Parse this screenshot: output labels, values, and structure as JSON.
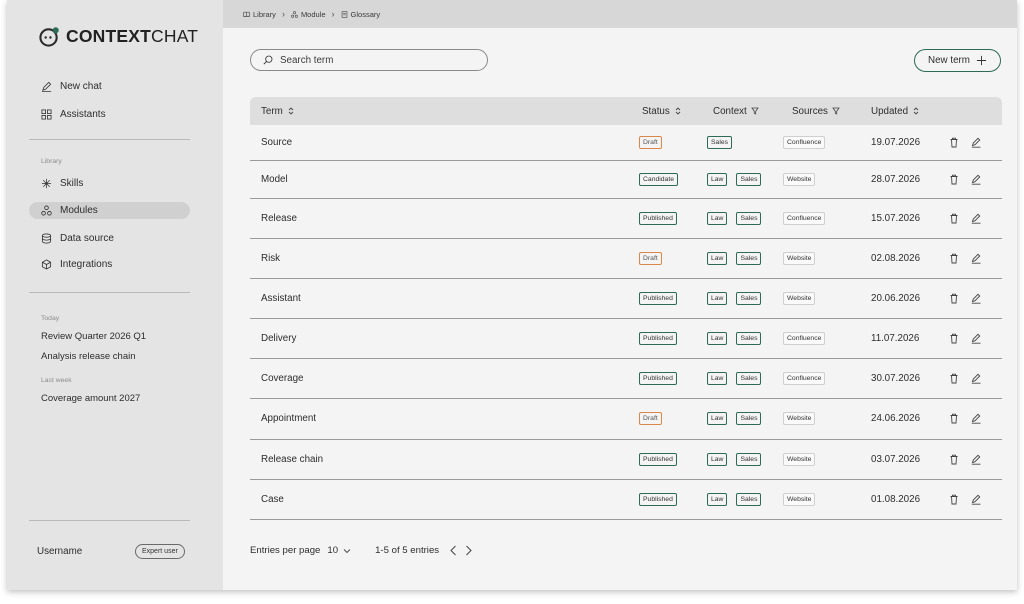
{
  "app": {
    "logo_bold": "CONTEXT",
    "logo_light": "CHAT"
  },
  "breadcrumb": [
    {
      "label": "Library",
      "icon": "book-icon"
    },
    {
      "label": "Module",
      "icon": "module-icon"
    },
    {
      "label": "Glossary",
      "icon": "glossary-icon"
    }
  ],
  "sidebar": {
    "primary": [
      {
        "label": "New chat",
        "icon": "pencil-icon"
      },
      {
        "label": "Assistants",
        "icon": "grid-icon"
      }
    ],
    "library_label": "Library",
    "library": [
      {
        "label": "Skills",
        "icon": "sparkle-icon"
      },
      {
        "label": "Modules",
        "icon": "modules-icon",
        "active": true
      },
      {
        "label": "Data source",
        "icon": "database-icon"
      },
      {
        "label": "Integrations",
        "icon": "cube-icon"
      }
    ],
    "history": [
      {
        "label": "Today",
        "items": [
          "Review Quarter 2026 Q1",
          "Analysis release chain"
        ]
      },
      {
        "label": "Last week",
        "items": [
          "Coverage amount 2027"
        ]
      }
    ],
    "user": {
      "name": "Username",
      "role": "Expert user"
    }
  },
  "toolbar": {
    "search_placeholder": "Search term",
    "new_term_label": "New term"
  },
  "table": {
    "columns": {
      "term": "Term",
      "status": "Status",
      "context": "Context",
      "sources": "Sources",
      "updated": "Updated"
    },
    "rows": [
      {
        "term": "Source",
        "status": "Draft",
        "context": [
          "Sales"
        ],
        "source": "Confluence",
        "updated": "19.07.2026"
      },
      {
        "term": "Model",
        "status": "Candidate",
        "context": [
          "Law",
          "Sales"
        ],
        "source": "Website",
        "updated": "28.07.2026"
      },
      {
        "term": "Release",
        "status": "Published",
        "context": [
          "Law",
          "Sales"
        ],
        "source": "Confluence",
        "updated": "15.07.2026"
      },
      {
        "term": "Risk",
        "status": "Draft",
        "context": [
          "Law",
          "Sales"
        ],
        "source": "Website",
        "updated": "02.08.2026"
      },
      {
        "term": "Assistant",
        "status": "Published",
        "context": [
          "Law",
          "Sales"
        ],
        "source": "Website",
        "updated": "20.06.2026"
      },
      {
        "term": "Delivery",
        "status": "Published",
        "context": [
          "Law",
          "Sales"
        ],
        "source": "Confluence",
        "updated": "11.07.2026"
      },
      {
        "term": "Coverage",
        "status": "Published",
        "context": [
          "Law",
          "Sales"
        ],
        "source": "Confluence",
        "updated": "30.07.2026"
      },
      {
        "term": "Appointment",
        "status": "Draft",
        "context": [
          "Law",
          "Sales"
        ],
        "source": "Website",
        "updated": "24.06.2026"
      },
      {
        "term": "Release chain",
        "status": "Published",
        "context": [
          "Law",
          "Sales"
        ],
        "source": "Website",
        "updated": "03.07.2026"
      },
      {
        "term": "Case",
        "status": "Published",
        "context": [
          "Law",
          "Sales"
        ],
        "source": "Website",
        "updated": "01.08.2026"
      }
    ]
  },
  "pagination": {
    "entries_label": "Entries per page",
    "per_page": "10",
    "range": "1-5 of 5 entries"
  },
  "colors": {
    "accent": "#2e6b55",
    "draft": "#d9874a",
    "sidebar_bg": "#e4e4e4",
    "main_bg": "#f4f4f4"
  }
}
